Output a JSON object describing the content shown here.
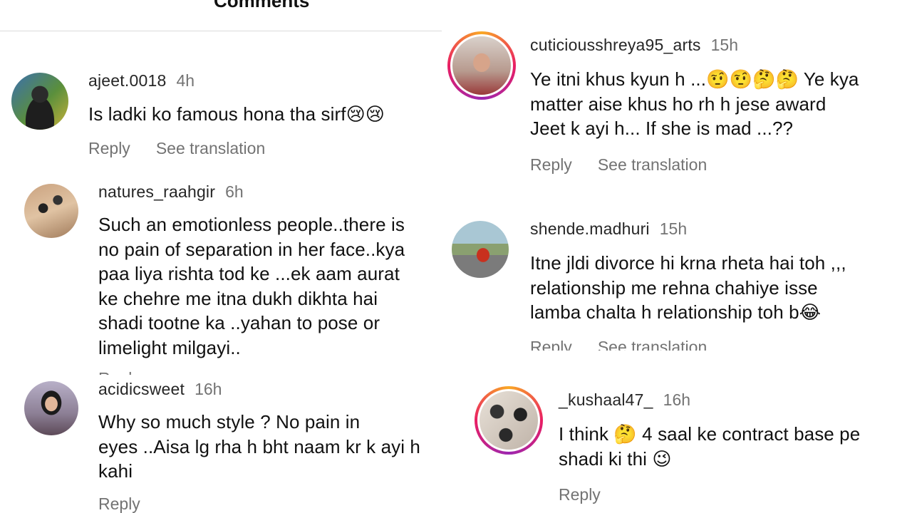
{
  "header": {
    "title": "Comments"
  },
  "left": [
    {
      "user": "ajeet.0018",
      "time": "4h",
      "text": "Is ladki ko famous hona tha sirf😢😢",
      "reply": "Reply",
      "translate": "See translation"
    },
    {
      "user": "natures_raahgir",
      "time": "6h",
      "text": "Such an emotionless people..there is\nno pain of separation in her face..kya\npaa liya rishta tod ke ...ek aam aurat\nke chehre me itna dukh dikhta hai\nshadi tootne ka ..yahan to pose or\nlimelight milgayi..",
      "reply": "Reply"
    },
    {
      "user": "acidicsweet",
      "time": "16h",
      "text": "Why so much style ? No pain in\neyes ..Aisa lg rha h bht naam kr k ayi h\nkahi",
      "reply": "Reply"
    }
  ],
  "right": [
    {
      "user": "cuticiousshreya95_arts",
      "time": "15h",
      "text": "Ye itni khus kyun h ...🤨🤨🤔🤔 Ye kya\nmatter aise khus ho rh h jese award\nJeet k ayi h... If she is mad ...??",
      "reply": "Reply",
      "translate": "See translation"
    },
    {
      "user": "shende.madhuri",
      "time": "15h",
      "text": "Itne jldi divorce hi krna rheta hai toh ,,,\nrelationship me rehna chahiye isse\nlamba chalta h relationship toh b😂",
      "reply": "Reply",
      "translate": "See translation"
    },
    {
      "user": "_kushaal47_",
      "time": "16h",
      "text": "I think 🤔 4 saal ke contract base pe\nshadi ki thi 😉",
      "reply": "Reply"
    }
  ],
  "colors": {
    "ring_start": "#f9a825",
    "ring_mid": "#e91e63",
    "ring_end": "#9c27b0",
    "muted": "#737373"
  }
}
